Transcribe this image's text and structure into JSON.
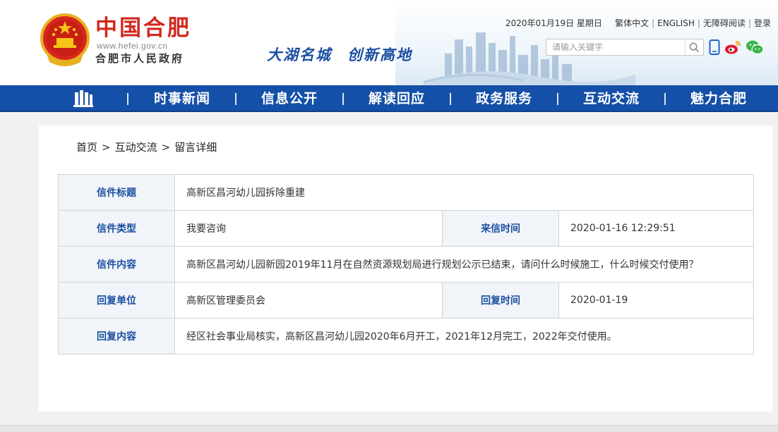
{
  "header": {
    "logo_title": "中国合肥",
    "logo_url": "www.hefei.gov.cn",
    "logo_subtitle": "合肥市人民政府",
    "slogan_part1": "大湖名城",
    "slogan_part2": "创新高地",
    "date": "2020年01月19日 星期日",
    "links": {
      "traditional": "繁体中文",
      "english": "ENGLISH",
      "accessible": "无障碍阅读",
      "login": "登录",
      "separator": "|"
    },
    "search": {
      "placeholder": "请输入关键字"
    }
  },
  "nav": {
    "items": [
      {
        "label": "时事新闻"
      },
      {
        "label": "信息公开"
      },
      {
        "label": "解读回应"
      },
      {
        "label": "政务服务"
      },
      {
        "label": "互动交流"
      },
      {
        "label": "魅力合肥"
      }
    ]
  },
  "breadcrumb": {
    "home": "首页",
    "section": "互动交流",
    "current": "留言详细",
    "arrow": ">"
  },
  "detail": {
    "title_label": "信件标题",
    "title_value": "高新区昌河幼儿园拆除重建",
    "type_label": "信件类型",
    "type_value": "我要咨询",
    "time_label": "来信时间",
    "time_value": "2020-01-16 12:29:51",
    "content_label": "信件内容",
    "content_value": "高新区昌河幼儿园新园2019年11月在自然资源规划局进行规划公示已结束，请问什么时候施工，什么时候交付使用？",
    "reply_unit_label": "回复单位",
    "reply_unit_value": "高新区管理委员会",
    "reply_time_label": "回复时间",
    "reply_time_value": "2020-01-19",
    "reply_content_label": "回复内容",
    "reply_content_value": "经区社会事业局核实，高新区昌河幼儿园2020年6月开工，2021年12月完工，2022年交付使用。"
  },
  "colors": {
    "nav_bg": "#1550a8",
    "logo_red": "#d2281e",
    "label_blue": "#1b4fa2",
    "label_bg": "#f1f4f8"
  },
  "icons": [
    "national-emblem-icon",
    "search-icon",
    "mobile-icon",
    "weibo-icon",
    "wechat-icon",
    "home-icon"
  ]
}
